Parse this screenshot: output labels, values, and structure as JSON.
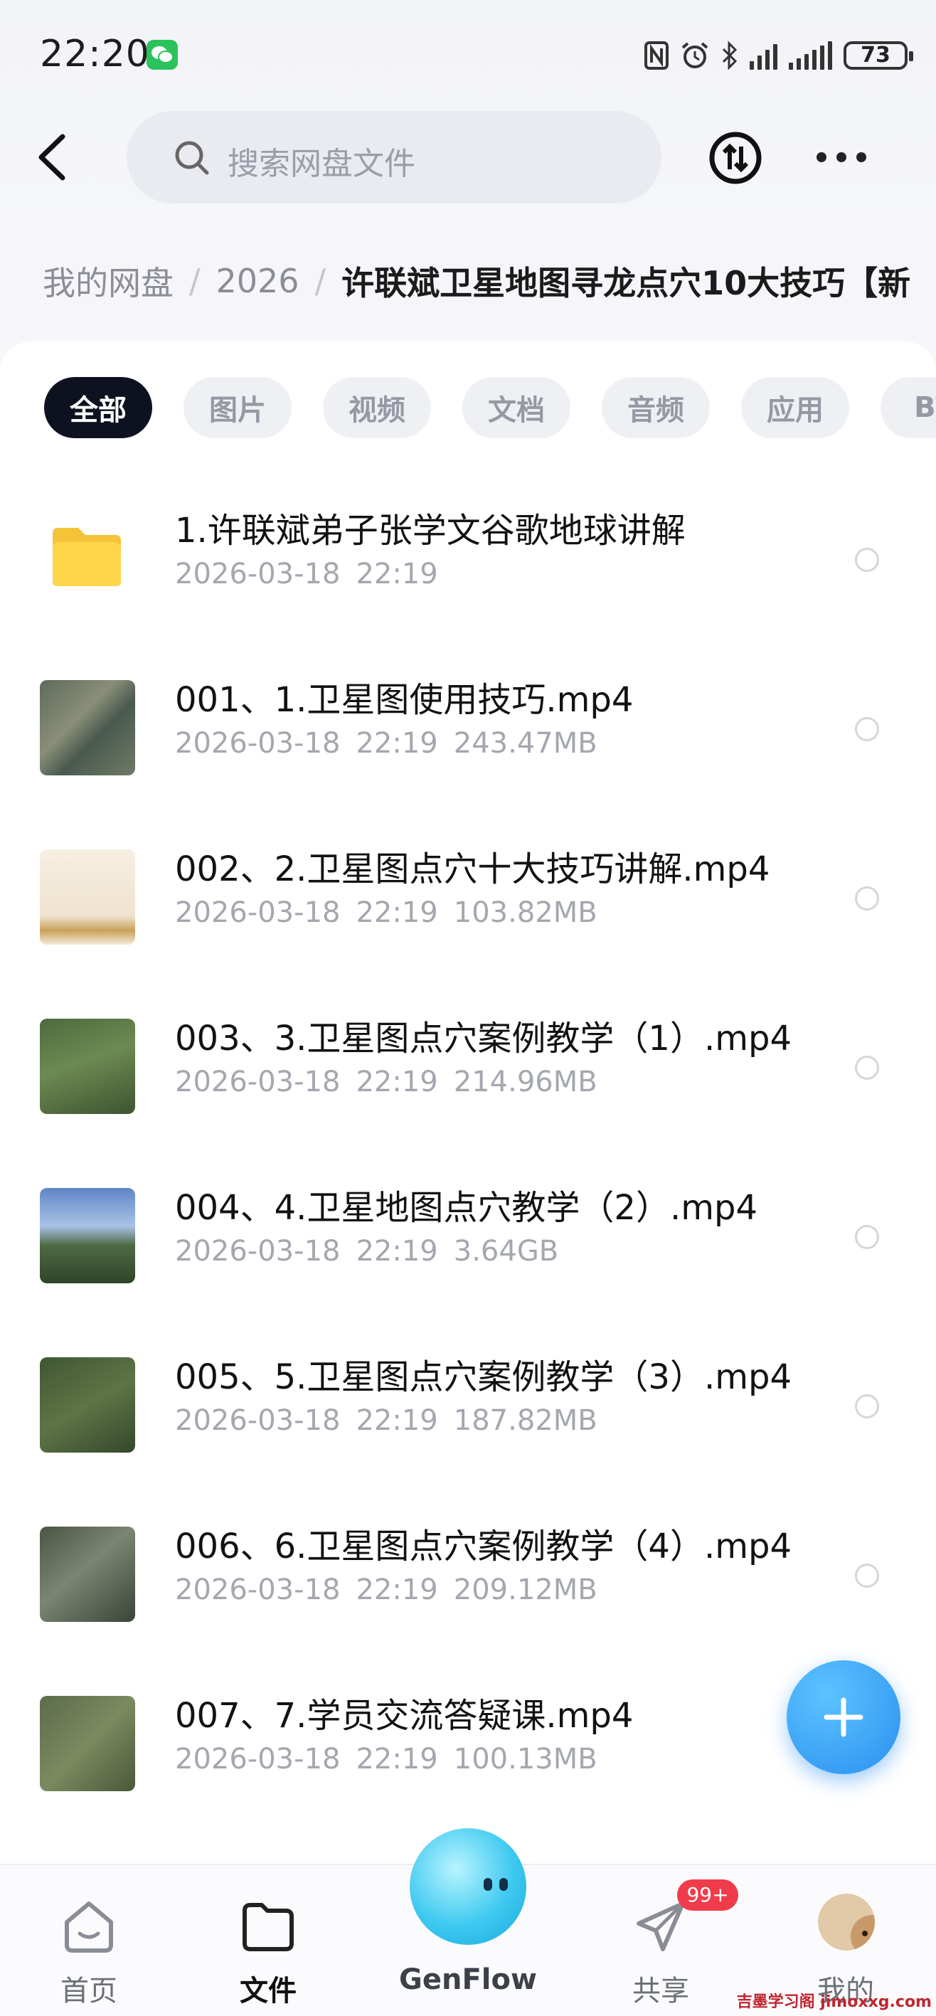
{
  "status_bar": {
    "time": "22:20",
    "battery": "73"
  },
  "header": {
    "search_placeholder": "搜索网盘文件"
  },
  "breadcrumb": {
    "items": [
      "我的网盘",
      "2026"
    ],
    "current": "许联斌卫星地图寻龙点穴10大技巧【新"
  },
  "filters": [
    "全部",
    "图片",
    "视频",
    "文档",
    "音频",
    "应用",
    "BT"
  ],
  "files": [
    {
      "name": "1.许联斌弟子张学文谷歌地球讲解",
      "date": "2026-03-18",
      "time": "22:19",
      "size": "",
      "type": "folder"
    },
    {
      "name": "001、1.卫星图使用技巧.mp4",
      "date": "2026-03-18",
      "time": "22:19",
      "size": "243.47MB",
      "type": "video"
    },
    {
      "name": "002、2.卫星图点穴十大技巧讲解.mp4",
      "date": "2026-03-18",
      "time": "22:19",
      "size": "103.82MB",
      "type": "video"
    },
    {
      "name": "003、3.卫星图点穴案例教学（1）.mp4",
      "date": "2026-03-18",
      "time": "22:19",
      "size": "214.96MB",
      "type": "video"
    },
    {
      "name": "004、4.卫星地图点穴教学（2）.mp4",
      "date": "2026-03-18",
      "time": "22:19",
      "size": "3.64GB",
      "type": "video"
    },
    {
      "name": "005、5.卫星图点穴案例教学（3）.mp4",
      "date": "2026-03-18",
      "time": "22:19",
      "size": "187.82MB",
      "type": "video"
    },
    {
      "name": "006、6.卫星图点穴案例教学（4）.mp4",
      "date": "2026-03-18",
      "time": "22:19",
      "size": "209.12MB",
      "type": "video"
    },
    {
      "name": "007、7.学员交流答疑课.mp4",
      "date": "2026-03-18",
      "time": "22:19",
      "size": "100.13MB",
      "type": "video"
    }
  ],
  "nav": {
    "home": "首页",
    "files": "文件",
    "genflow": "GenFlow",
    "share": "共享",
    "share_badge": "99+",
    "mine": "我的"
  },
  "watermark": "吉墨学习阁 jimoxxg.com",
  "colors": {
    "accent": "#2b8ff0",
    "active_chip": "#0e1220",
    "badge": "#f03c4a"
  }
}
